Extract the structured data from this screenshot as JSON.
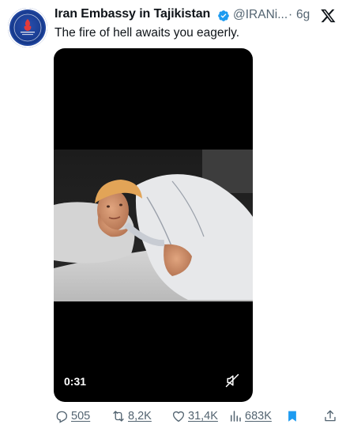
{
  "tweet": {
    "author_name": "Iran Embassy in Tajikistan",
    "handle": "@IRANi...",
    "separator": "·",
    "time": "6g",
    "text": "The fire of hell awaits you eagerly."
  },
  "video": {
    "duration": "0:31"
  },
  "actions": {
    "replies": "505",
    "retweets": "8,2K",
    "likes": "31,4K",
    "views": "683K"
  },
  "colors": {
    "verified_badge": "#1d9bf0",
    "muted_text": "#536471",
    "bookmark": "#1d9bf0"
  },
  "icons": [
    "verified-badge-icon",
    "x-logo-icon",
    "mute-icon",
    "reply-icon",
    "retweet-icon",
    "like-icon",
    "views-icon",
    "bookmark-icon",
    "share-icon"
  ]
}
